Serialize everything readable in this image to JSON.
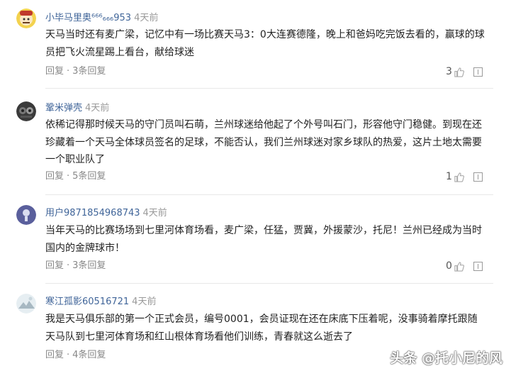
{
  "comments": [
    {
      "user": "小毕马里奥⁶⁶⁶₆₆₆953",
      "time": "4天前",
      "lines": [
        "天马当时还有麦广梁，记忆中有一场比赛天马3：0大连赛德隆，晚上和爸妈吃完饭去看的，赢球的球",
        "员把飞火流星踢上看台，献给球迷"
      ],
      "reply": "回复",
      "dot": "·",
      "replies": "3条回复",
      "likes": "3"
    },
    {
      "user": "鞏米弹壳",
      "time": "4天前",
      "lines": [
        "依稀记得那时候天马的守门员叫石萌，兰州球迷给他起了个外号叫石门，形容他守门稳健。到现在还",
        "珍藏着一个天马全体球员签名的足球，不能否认，我们兰州球迷对家乡球队的热爱，这片土地太需要",
        "一个职业队了"
      ],
      "reply": "回复",
      "dot": "·",
      "replies": "5条回复",
      "likes": "1"
    },
    {
      "user": "用户9871854968743",
      "time": "4天前",
      "lines": [
        "当年天马的比赛场场到七里河体育场看，麦广梁，任猛，贾冀，外援蒙沙，托尼！兰州已经成为当时",
        "国内的金牌球市！"
      ],
      "reply": "回复",
      "dot": "·",
      "replies": "3条回复",
      "likes": "0"
    },
    {
      "user": "寒江孤影60516721",
      "time": "4天前",
      "lines": [
        "我是天马俱乐部的第一个正式会员，编号0001，会员证现在还在床底下压着呢，没事骑着摩托跟随",
        "天马队到七里河体育场和红山根体育场看他们训练，青春就这么逝去了"
      ],
      "reply": "回复",
      "dot": "·",
      "replies": "4条回复",
      "likes": ""
    }
  ],
  "watermark": "头条 @托小尼的风",
  "colors": {
    "username": "#406599",
    "meta": "#999999",
    "text": "#222222"
  },
  "icons": [
    "avatar",
    "thumb-up-icon",
    "report-icon"
  ]
}
